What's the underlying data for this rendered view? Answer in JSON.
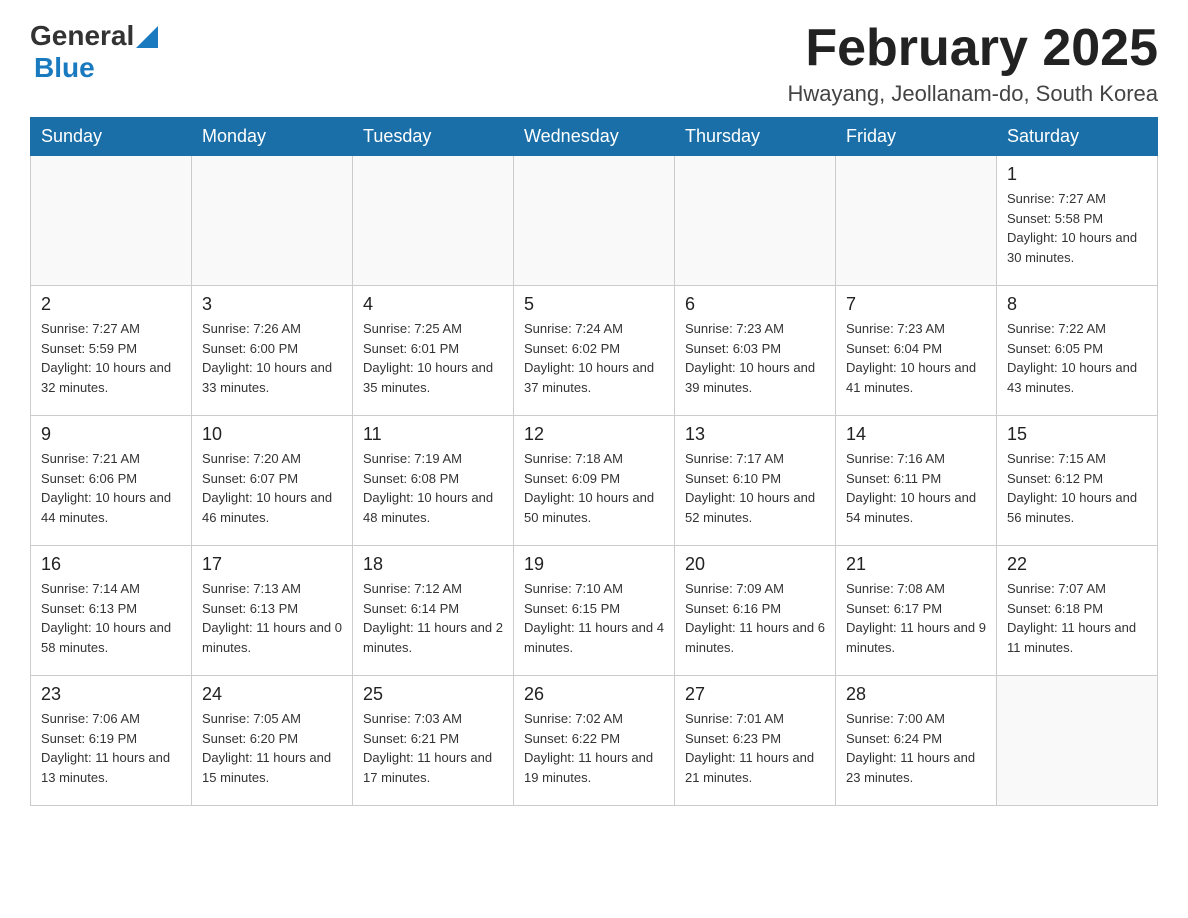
{
  "header": {
    "logo_general": "General",
    "logo_blue": "Blue",
    "month_title": "February 2025",
    "location": "Hwayang, Jeollanam-do, South Korea"
  },
  "days_of_week": [
    "Sunday",
    "Monday",
    "Tuesday",
    "Wednesday",
    "Thursday",
    "Friday",
    "Saturday"
  ],
  "weeks": [
    [
      {
        "day": "",
        "info": ""
      },
      {
        "day": "",
        "info": ""
      },
      {
        "day": "",
        "info": ""
      },
      {
        "day": "",
        "info": ""
      },
      {
        "day": "",
        "info": ""
      },
      {
        "day": "",
        "info": ""
      },
      {
        "day": "1",
        "info": "Sunrise: 7:27 AM\nSunset: 5:58 PM\nDaylight: 10 hours and 30 minutes."
      }
    ],
    [
      {
        "day": "2",
        "info": "Sunrise: 7:27 AM\nSunset: 5:59 PM\nDaylight: 10 hours and 32 minutes."
      },
      {
        "day": "3",
        "info": "Sunrise: 7:26 AM\nSunset: 6:00 PM\nDaylight: 10 hours and 33 minutes."
      },
      {
        "day": "4",
        "info": "Sunrise: 7:25 AM\nSunset: 6:01 PM\nDaylight: 10 hours and 35 minutes."
      },
      {
        "day": "5",
        "info": "Sunrise: 7:24 AM\nSunset: 6:02 PM\nDaylight: 10 hours and 37 minutes."
      },
      {
        "day": "6",
        "info": "Sunrise: 7:23 AM\nSunset: 6:03 PM\nDaylight: 10 hours and 39 minutes."
      },
      {
        "day": "7",
        "info": "Sunrise: 7:23 AM\nSunset: 6:04 PM\nDaylight: 10 hours and 41 minutes."
      },
      {
        "day": "8",
        "info": "Sunrise: 7:22 AM\nSunset: 6:05 PM\nDaylight: 10 hours and 43 minutes."
      }
    ],
    [
      {
        "day": "9",
        "info": "Sunrise: 7:21 AM\nSunset: 6:06 PM\nDaylight: 10 hours and 44 minutes."
      },
      {
        "day": "10",
        "info": "Sunrise: 7:20 AM\nSunset: 6:07 PM\nDaylight: 10 hours and 46 minutes."
      },
      {
        "day": "11",
        "info": "Sunrise: 7:19 AM\nSunset: 6:08 PM\nDaylight: 10 hours and 48 minutes."
      },
      {
        "day": "12",
        "info": "Sunrise: 7:18 AM\nSunset: 6:09 PM\nDaylight: 10 hours and 50 minutes."
      },
      {
        "day": "13",
        "info": "Sunrise: 7:17 AM\nSunset: 6:10 PM\nDaylight: 10 hours and 52 minutes."
      },
      {
        "day": "14",
        "info": "Sunrise: 7:16 AM\nSunset: 6:11 PM\nDaylight: 10 hours and 54 minutes."
      },
      {
        "day": "15",
        "info": "Sunrise: 7:15 AM\nSunset: 6:12 PM\nDaylight: 10 hours and 56 minutes."
      }
    ],
    [
      {
        "day": "16",
        "info": "Sunrise: 7:14 AM\nSunset: 6:13 PM\nDaylight: 10 hours and 58 minutes."
      },
      {
        "day": "17",
        "info": "Sunrise: 7:13 AM\nSunset: 6:13 PM\nDaylight: 11 hours and 0 minutes."
      },
      {
        "day": "18",
        "info": "Sunrise: 7:12 AM\nSunset: 6:14 PM\nDaylight: 11 hours and 2 minutes."
      },
      {
        "day": "19",
        "info": "Sunrise: 7:10 AM\nSunset: 6:15 PM\nDaylight: 11 hours and 4 minutes."
      },
      {
        "day": "20",
        "info": "Sunrise: 7:09 AM\nSunset: 6:16 PM\nDaylight: 11 hours and 6 minutes."
      },
      {
        "day": "21",
        "info": "Sunrise: 7:08 AM\nSunset: 6:17 PM\nDaylight: 11 hours and 9 minutes."
      },
      {
        "day": "22",
        "info": "Sunrise: 7:07 AM\nSunset: 6:18 PM\nDaylight: 11 hours and 11 minutes."
      }
    ],
    [
      {
        "day": "23",
        "info": "Sunrise: 7:06 AM\nSunset: 6:19 PM\nDaylight: 11 hours and 13 minutes."
      },
      {
        "day": "24",
        "info": "Sunrise: 7:05 AM\nSunset: 6:20 PM\nDaylight: 11 hours and 15 minutes."
      },
      {
        "day": "25",
        "info": "Sunrise: 7:03 AM\nSunset: 6:21 PM\nDaylight: 11 hours and 17 minutes."
      },
      {
        "day": "26",
        "info": "Sunrise: 7:02 AM\nSunset: 6:22 PM\nDaylight: 11 hours and 19 minutes."
      },
      {
        "day": "27",
        "info": "Sunrise: 7:01 AM\nSunset: 6:23 PM\nDaylight: 11 hours and 21 minutes."
      },
      {
        "day": "28",
        "info": "Sunrise: 7:00 AM\nSunset: 6:24 PM\nDaylight: 11 hours and 23 minutes."
      },
      {
        "day": "",
        "info": ""
      }
    ]
  ]
}
